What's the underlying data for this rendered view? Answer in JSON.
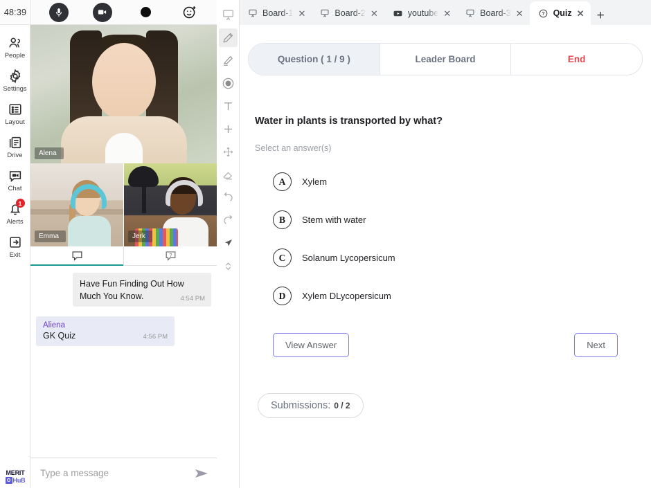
{
  "meeting": {
    "timer": "48:39",
    "controls": [
      {
        "name": "microphone-button",
        "icon": "microphone-icon"
      },
      {
        "name": "camera-button",
        "icon": "camera-icon"
      },
      {
        "name": "record-button",
        "icon": "record-dot-icon"
      },
      {
        "name": "reaction-button",
        "icon": "emoji-icon"
      }
    ],
    "participants": [
      {
        "name": "Alena"
      },
      {
        "name": "Emma"
      },
      {
        "name": "Jerk"
      }
    ]
  },
  "sidebar": {
    "items": [
      {
        "label": "People",
        "icon": "people-icon"
      },
      {
        "label": "Settings",
        "icon": "gear-icon"
      },
      {
        "label": "Layout",
        "icon": "layout-icon"
      },
      {
        "label": "Drive",
        "icon": "drive-icon"
      },
      {
        "label": "Chat",
        "icon": "chat-icon"
      },
      {
        "label": "Alerts",
        "icon": "bell-icon",
        "badge": "1"
      },
      {
        "label": "Exit",
        "icon": "exit-icon"
      }
    ],
    "logo": {
      "top": "MERIT",
      "mark": "O",
      "bottom": "HuB"
    }
  },
  "chat": {
    "tabs": [
      {
        "name": "chat-tab",
        "icon": "speech-bubble-icon",
        "active": true
      },
      {
        "name": "qa-tab",
        "icon": "question-bubble-icon",
        "active": false
      }
    ],
    "messages": [
      {
        "direction": "out",
        "sender": "",
        "text": "Have Fun Finding Out How Much You Know.",
        "time": "4:54 PM"
      },
      {
        "direction": "in",
        "sender": "Aliena",
        "text": "GK Quiz",
        "time": "4:56 PM"
      }
    ],
    "input": {
      "placeholder": "Type a message",
      "value": "",
      "send_icon": "send-icon"
    }
  },
  "toolrail": {
    "tools": [
      {
        "name": "board-tool",
        "icon": "whiteboard-icon",
        "active": false
      },
      {
        "name": "pencil-tool",
        "icon": "pencil-icon",
        "active": true
      },
      {
        "name": "highlighter-tool",
        "icon": "highlighter-icon",
        "active": false
      },
      {
        "name": "color-tool",
        "icon": "filled-circle-icon",
        "active": false
      },
      {
        "name": "text-tool",
        "icon": "text-icon",
        "active": false
      },
      {
        "name": "add-tool",
        "icon": "plus-icon",
        "active": false
      },
      {
        "name": "move-tool",
        "icon": "move-icon",
        "active": false
      },
      {
        "name": "eraser-tool",
        "icon": "eraser-icon",
        "active": false
      },
      {
        "name": "undo-tool",
        "icon": "undo-icon",
        "active": false
      },
      {
        "name": "redo-tool",
        "icon": "redo-icon",
        "active": false
      },
      {
        "name": "select-tool",
        "icon": "cursor-icon",
        "active": false
      },
      {
        "name": "page-nav",
        "icon": "chevron-updown-icon",
        "active": false
      }
    ]
  },
  "browser": {
    "tabs": [
      {
        "label": "Board-1",
        "icon": "board-icon",
        "active": false,
        "fade": true
      },
      {
        "label": "Board-2",
        "icon": "board-icon",
        "active": false,
        "fade": true
      },
      {
        "label": "youtube",
        "icon": "youtube-icon",
        "active": false,
        "fade": true
      },
      {
        "label": "Board-3",
        "icon": "board-icon",
        "active": false,
        "fade": true
      },
      {
        "label": "Quiz",
        "icon": "question-circle-icon",
        "active": true,
        "fade": false
      }
    ],
    "new_tab": "+"
  },
  "quiz": {
    "tabs": [
      {
        "label": "Question ( 1 / 9 )",
        "selected": true,
        "danger": false
      },
      {
        "label": "Leader Board",
        "selected": false,
        "danger": false
      },
      {
        "label": "End",
        "selected": false,
        "danger": true
      }
    ],
    "question": "Water in plants is transported by what?",
    "hint": "Select an answer(s)",
    "options": [
      {
        "key": "A",
        "label": "Xylem"
      },
      {
        "key": "B",
        "label": "Stem with water"
      },
      {
        "key": "C",
        "label": "Solanum Lycopersicum"
      },
      {
        "key": "D",
        "label": "Xylem DLycopersicum"
      }
    ],
    "view_answer_label": "View Answer",
    "next_label": "Next",
    "submissions_label": "Submissions:",
    "submissions_value": "0 / 2"
  },
  "colors": {
    "accent_purple": "#7b7bea",
    "danger_red": "#e4484f",
    "badge_red": "#e0252b",
    "tab_selected_bg": "#eef1f6",
    "chat_active_underline": "#1a9a8f"
  }
}
